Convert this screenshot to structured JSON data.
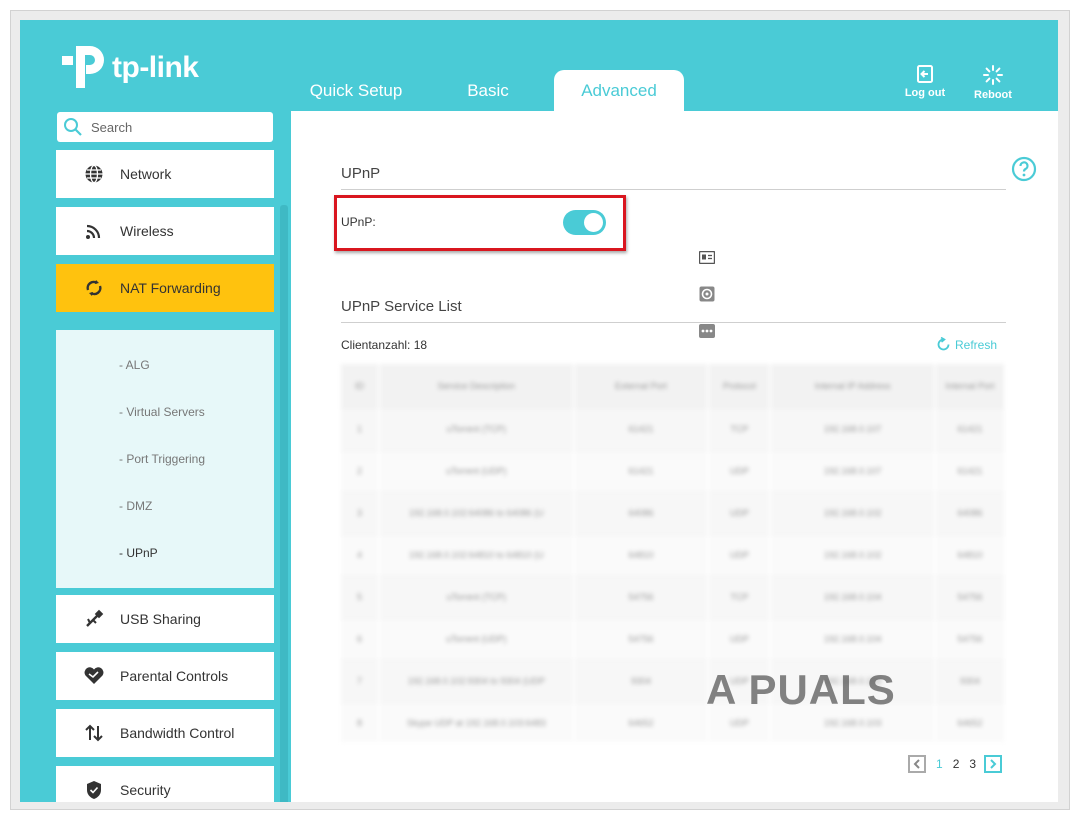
{
  "brand": {
    "name": "tp-link",
    "accent": "#4acbd6",
    "highlight": "#ffc20e"
  },
  "header": {
    "tabs": [
      {
        "label": "Quick Setup",
        "active": false
      },
      {
        "label": "Basic",
        "active": false
      },
      {
        "label": "Advanced",
        "active": true
      }
    ],
    "logout_label": "Log out",
    "reboot_label": "Reboot"
  },
  "search": {
    "placeholder": "Search"
  },
  "sidebar": {
    "items": [
      {
        "label": "Network",
        "icon": "globe-icon"
      },
      {
        "label": "Wireless",
        "icon": "wifi-icon"
      },
      {
        "label": "NAT Forwarding",
        "icon": "nat-icon",
        "active": true
      },
      {
        "label": "USB Sharing",
        "icon": "usb-icon"
      },
      {
        "label": "Parental Controls",
        "icon": "heart-icon"
      },
      {
        "label": "Bandwidth Control",
        "icon": "bandwidth-icon"
      },
      {
        "label": "Security",
        "icon": "shield-icon"
      }
    ],
    "submenu": [
      {
        "label": "- ALG"
      },
      {
        "label": "- Virtual Servers"
      },
      {
        "label": "- Port Triggering"
      },
      {
        "label": "- DMZ"
      },
      {
        "label": "- UPnP",
        "active": true
      }
    ]
  },
  "main": {
    "section_title": "UPnP",
    "upnp_label": "UPnP:",
    "upnp_enabled": true,
    "service_list_title": "UPnP Service List",
    "client_count": "Clientanzahl: 18",
    "refresh_label": "Refresh",
    "table": {
      "headers": [
        "ID",
        "Service Description",
        "External Port",
        "Protocol",
        "Internal IP Address",
        "Internal Port"
      ],
      "rows": [
        [
          "1",
          "uTorrent (TCP)",
          "61421",
          "TCP",
          "192.168.0.107",
          "61421"
        ],
        [
          "2",
          "uTorrent (UDP)",
          "61421",
          "UDP",
          "192.168.0.107",
          "61421"
        ],
        [
          "3",
          "192.168.0.102:64086 to 64086 (U",
          "64086",
          "UDP",
          "192.168.0.102",
          "64086"
        ],
        [
          "4",
          "192.168.0.102:64810 to 64810 (U",
          "64810",
          "UDP",
          "192.168.0.102",
          "64810"
        ],
        [
          "5",
          "uTorrent (TCP)",
          "54756",
          "TCP",
          "192.168.0.104",
          "54756"
        ],
        [
          "6",
          "uTorrent (UDP)",
          "54756",
          "UDP",
          "192.168.0.104",
          "54756"
        ],
        [
          "7",
          "192.168.0.102:9304 to 9304 (UDP",
          "9304",
          "UDP",
          "192.168.0.102",
          "9304"
        ],
        [
          "8",
          "Skype UDP at 192.168.0.103:6483",
          "64652",
          "UDP",
          "192.168.0.103",
          "64652"
        ]
      ]
    },
    "pagination": {
      "pages": [
        "1",
        "2",
        "3"
      ],
      "current": "1"
    },
    "watermark": "A PUALS"
  }
}
